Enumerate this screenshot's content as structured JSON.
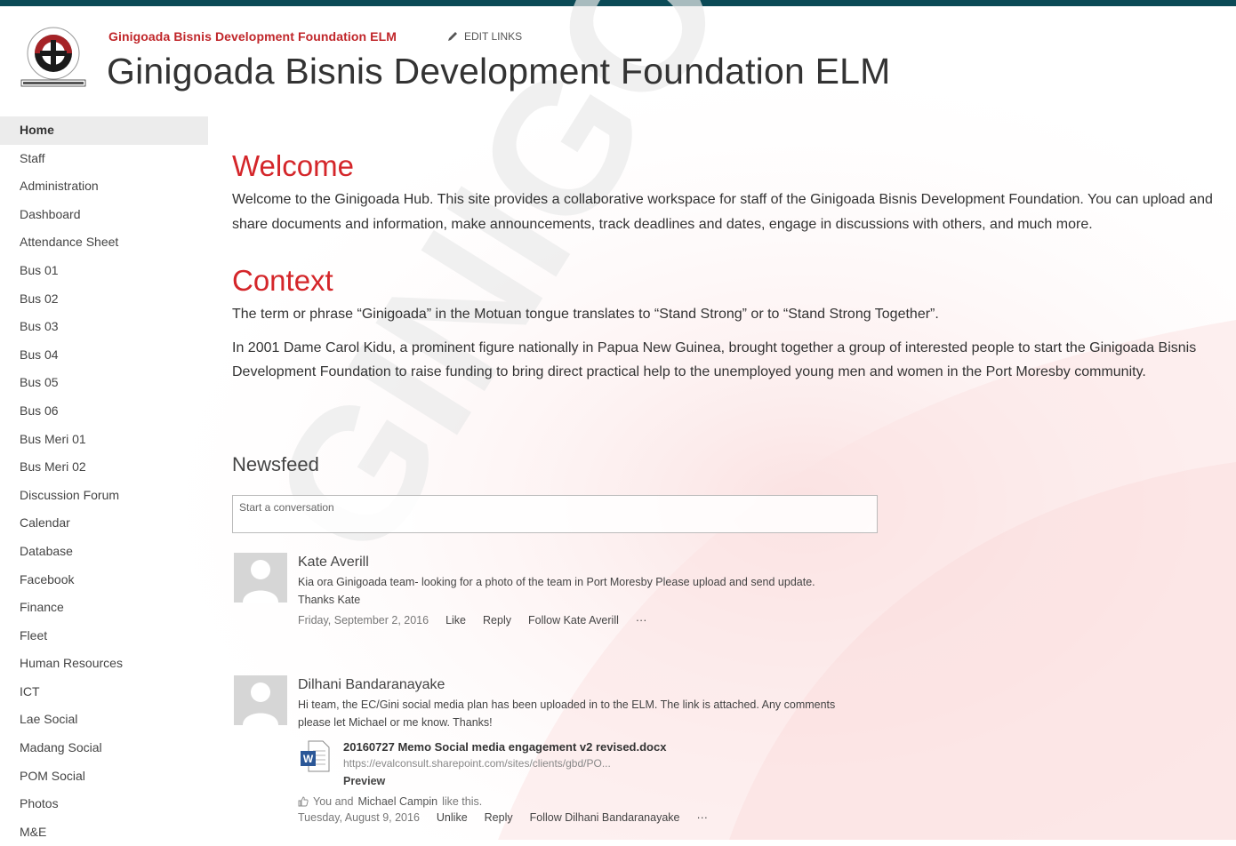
{
  "header": {
    "site_link": "Ginigoada Bisnis Development Foundation ELM",
    "edit_links": "EDIT LINKS",
    "title": "Ginigoada Bisnis Development Foundation ELM",
    "logo_icon": "ginigoada-logo-icon"
  },
  "watermark_text": "GINIGOADA BISNIS DEVELOPMENT",
  "colors": {
    "topbar": "#0b4a56",
    "heading_red": "#d4262a",
    "site_link_red": "#c0262a",
    "nav_active_bg": "#ececec"
  },
  "nav": {
    "items": [
      {
        "label": "Home",
        "active": true
      },
      {
        "label": "Staff"
      },
      {
        "label": "Administration"
      },
      {
        "label": "Dashboard"
      },
      {
        "label": "Attendance Sheet"
      },
      {
        "label": "Bus 01"
      },
      {
        "label": "Bus 02"
      },
      {
        "label": "Bus 03"
      },
      {
        "label": "Bus 04"
      },
      {
        "label": "Bus 05"
      },
      {
        "label": "Bus 06"
      },
      {
        "label": "Bus Meri 01"
      },
      {
        "label": "Bus Meri 02"
      },
      {
        "label": "Discussion Forum"
      },
      {
        "label": "Calendar"
      },
      {
        "label": "Database"
      },
      {
        "label": "Facebook"
      },
      {
        "label": "Finance"
      },
      {
        "label": "Fleet"
      },
      {
        "label": "Human Resources"
      },
      {
        "label": "ICT"
      },
      {
        "label": "Lae Social"
      },
      {
        "label": "Madang Social"
      },
      {
        "label": "POM Social"
      },
      {
        "label": "Photos"
      },
      {
        "label": "M&E"
      }
    ]
  },
  "main": {
    "welcome_heading": "Welcome",
    "welcome_text": "Welcome to the Ginigoada Hub. This site provides a collaborative workspace for staff of the Ginigoada Bisnis Development Foundation. You can upload and share documents and information, make announcements, track deadlines and dates, engage in discussions with others, and much more.",
    "context_heading": "Context",
    "context_text_1": "The term or phrase “Ginigoada” in the Motuan tongue translates to “Stand Strong” or to “Stand Strong Together”.",
    "context_text_2": "In 2001 Dame Carol Kidu, a prominent figure nationally in Papua New Guinea, brought together a group of interested people to start the Ginigoada Bisnis Development Foundation to raise funding to bring direct practical help to the unemployed young men and women in the Port Moresby community."
  },
  "newsfeed": {
    "heading": "Newsfeed",
    "placeholder": "Start a conversation",
    "posts": [
      {
        "author": "Kate Averill",
        "text": "Kia ora Ginigoada team- looking for a photo of the team in Port Moresby Please upload and send update.",
        "text2": "Thanks Kate",
        "date": "Friday, September 2, 2016",
        "like": "Like",
        "reply": "Reply",
        "follow": "Follow Kate Averill",
        "more": "···"
      },
      {
        "author": "Dilhani Bandaranayake",
        "text": "Hi team, the EC/Gini social media plan has been uploaded in to the ELM. The link is attached. Any comments please let Michael or me know. Thanks!",
        "attachment": {
          "name": "20160727 Memo Social media engagement v2 revised.docx",
          "url": "https://evalconsult.sharepoint.com/sites/clients/gbd/PO...",
          "preview": "Preview",
          "icon": "word-document-icon"
        },
        "likes_prefix": "You and",
        "likes_name": "Michael Campin",
        "likes_suffix": "like this.",
        "date": "Tuesday, August 9, 2016",
        "like": "Unlike",
        "reply": "Reply",
        "follow": "Follow Dilhani Bandaranayake",
        "more": "···"
      }
    ]
  }
}
